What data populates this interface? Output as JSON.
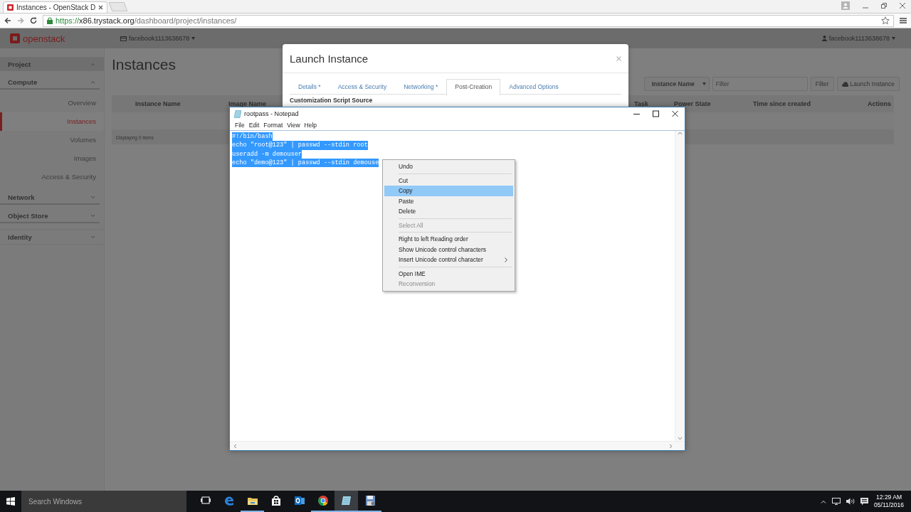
{
  "browser": {
    "tabs": [
      {
        "title": "Instances - OpenStack D",
        "selected": true
      }
    ],
    "url": {
      "scheme": "https://",
      "host": "x86.trystack.org",
      "path": "/dashboard/project/instances/"
    }
  },
  "header": {
    "logo_text": "openstack",
    "project": "facebook1113638678",
    "user": "facebook1113638678"
  },
  "sidebar": {
    "panel": {
      "label": "Project",
      "expanded": true
    },
    "groups": [
      {
        "label": "Compute",
        "expanded": true,
        "items": [
          {
            "label": "Overview",
            "selected": false
          },
          {
            "label": "Instances",
            "selected": true
          },
          {
            "label": "Volumes",
            "selected": false
          },
          {
            "label": "Images",
            "selected": false
          },
          {
            "label": "Access & Security",
            "selected": false
          }
        ]
      },
      {
        "label": "Network",
        "expanded": false
      },
      {
        "label": "Object Store",
        "expanded": false
      }
    ],
    "dashboards": [
      {
        "label": "Identity",
        "expanded": false
      }
    ]
  },
  "page": {
    "title": "Instances",
    "filter_select": "Instance Name",
    "filter_placeholder": "Filter",
    "filter_button": "Filter",
    "launch_button": "Launch Instance",
    "table": {
      "columns": [
        "Instance Name",
        "Image Name",
        "Task",
        "Power State",
        "Time since created",
        "Actions"
      ],
      "footer": "Displaying 0 items"
    }
  },
  "modal": {
    "title": "Launch Instance",
    "tabs": [
      {
        "label": "Details *",
        "selected": false
      },
      {
        "label": "Access & Security",
        "selected": false
      },
      {
        "label": "Networking *",
        "selected": false
      },
      {
        "label": "Post-Creation",
        "selected": true
      },
      {
        "label": "Advanced Options",
        "selected": false
      }
    ],
    "section_label": "Customization Script Source"
  },
  "notepad": {
    "title": "rootpass - Notepad",
    "menu": [
      "File",
      "Edit",
      "Format",
      "View",
      "Help"
    ],
    "lines": [
      {
        "text": "#!/bin/bash",
        "selected": true
      },
      {
        "text": "echo \"root@123\" | passwd --stdin root",
        "selected": true
      },
      {
        "text": "useradd -m demouser",
        "selected": true
      },
      {
        "text": "echo \"demo@123\" | passwd --stdin demouse",
        "selected": true
      }
    ]
  },
  "context_menu": {
    "items": [
      {
        "kind": "item",
        "label": "Undo",
        "selected": false,
        "disabled": false
      },
      {
        "kind": "separator"
      },
      {
        "kind": "item",
        "label": "Cut",
        "selected": false,
        "disabled": false
      },
      {
        "kind": "item",
        "label": "Copy",
        "selected": true,
        "disabled": false
      },
      {
        "kind": "item",
        "label": "Paste",
        "selected": false,
        "disabled": false
      },
      {
        "kind": "item",
        "label": "Delete",
        "selected": false,
        "disabled": false
      },
      {
        "kind": "separator"
      },
      {
        "kind": "item",
        "label": "Select All",
        "selected": false,
        "disabled": true
      },
      {
        "kind": "separator"
      },
      {
        "kind": "item",
        "label": "Right to left Reading order",
        "selected": false,
        "disabled": false
      },
      {
        "kind": "item",
        "label": "Show Unicode control characters",
        "selected": false,
        "disabled": false
      },
      {
        "kind": "submenu",
        "label": "Insert Unicode control character",
        "selected": false,
        "disabled": false
      },
      {
        "kind": "separator"
      },
      {
        "kind": "item",
        "label": "Open IME",
        "selected": false,
        "disabled": false
      },
      {
        "kind": "item",
        "label": "Reconversion",
        "selected": false,
        "disabled": true
      }
    ]
  },
  "taskbar": {
    "search_placeholder": "Search Windows",
    "apps": [
      {
        "kind": "taskview",
        "running": false,
        "selected": false
      },
      {
        "kind": "edge",
        "running": false,
        "selected": false
      },
      {
        "kind": "folder",
        "running": true,
        "selected": false
      },
      {
        "kind": "store",
        "running": false,
        "selected": false
      },
      {
        "kind": "outlook",
        "running": false,
        "selected": false
      },
      {
        "kind": "chrome",
        "running": true,
        "selected": false
      },
      {
        "kind": "notepad",
        "running": true,
        "selected": true
      },
      {
        "kind": "floppy",
        "running": true,
        "selected": false
      }
    ],
    "time": "12:29 AM",
    "date": "05/11/2016"
  }
}
